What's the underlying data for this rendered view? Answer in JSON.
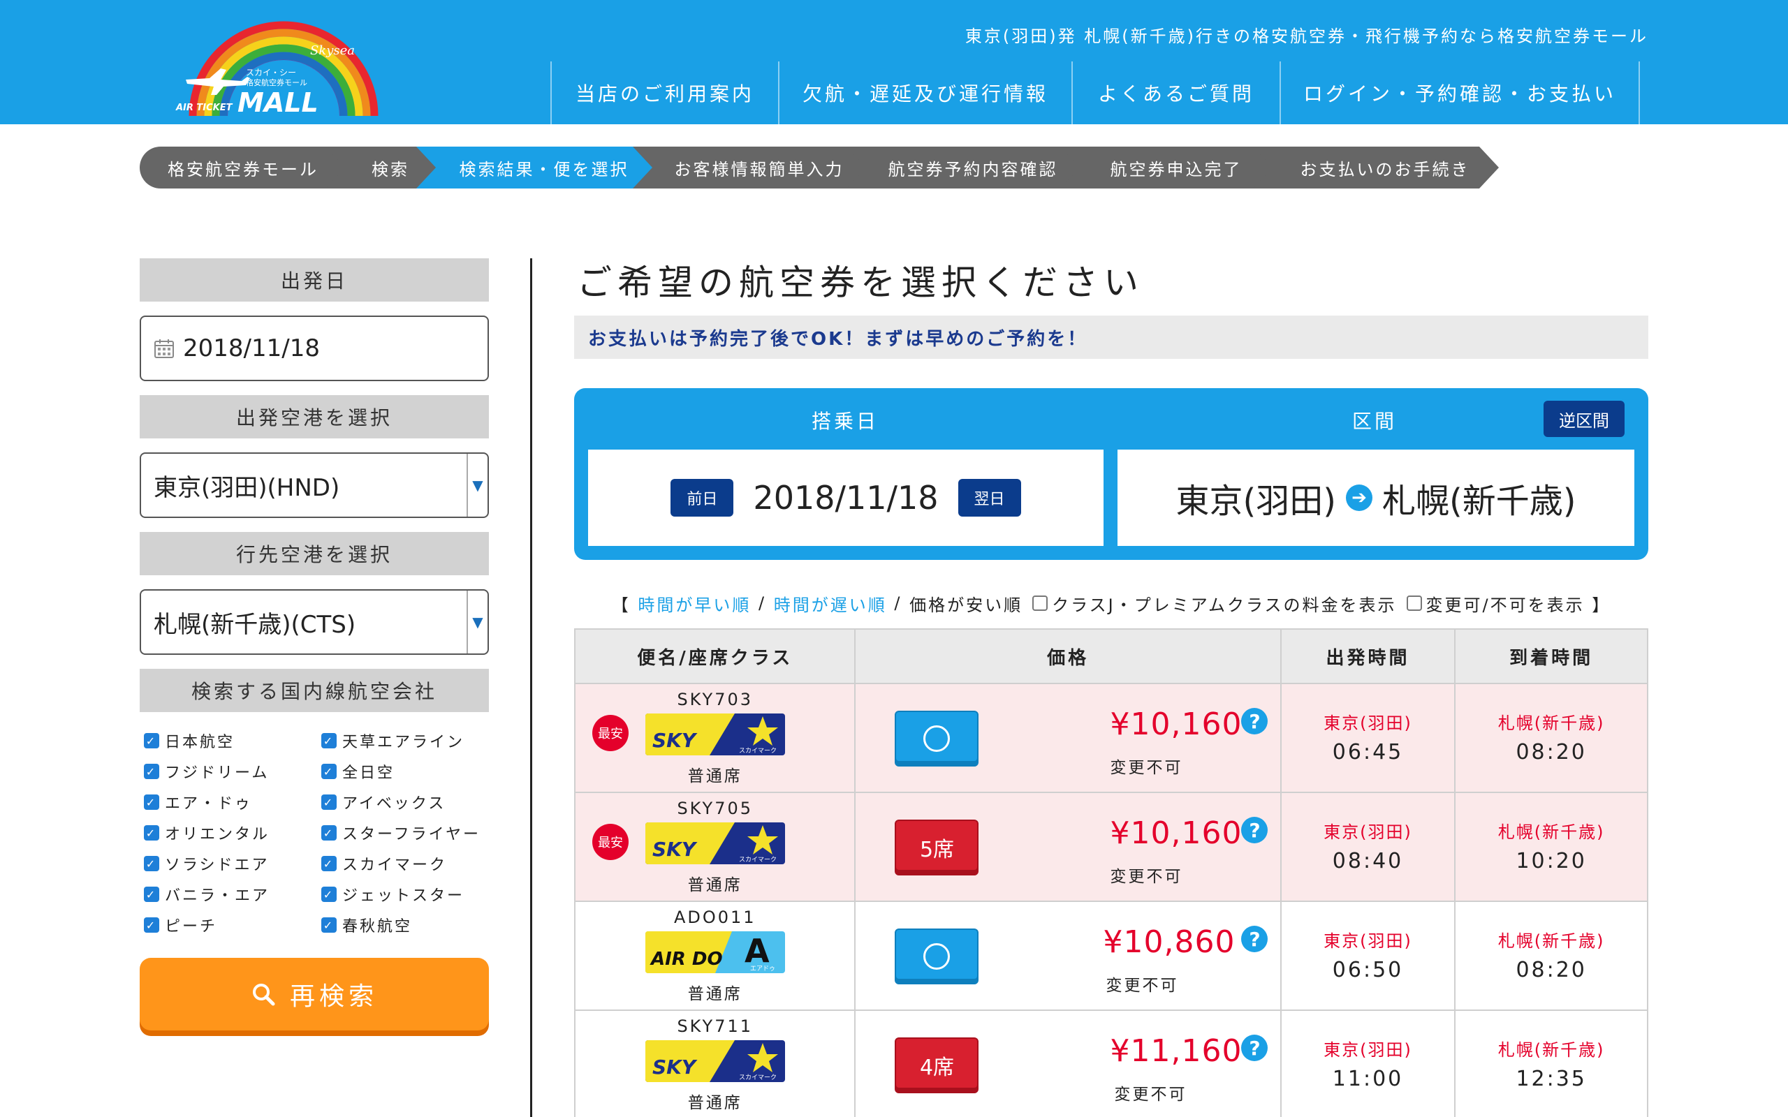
{
  "header": {
    "tagline": "東京(羽田)発 札幌(新千歳)行きの格安航空券・飛行機予約なら格安航空券モール",
    "logo": {
      "brand_small": "スカイ・シー",
      "brand_sub": "格安航空券モール",
      "script_text": "Skysea",
      "air_ticket": "AIR TICKET",
      "mall": "MALL"
    },
    "nav": [
      {
        "label": "当店のご利用案内"
      },
      {
        "label": "欠航・遅延及び運行情報"
      },
      {
        "label": "よくあるご質問"
      },
      {
        "label": "ログイン・予約確認・お支払い"
      }
    ]
  },
  "breadcrumb": [
    {
      "label": "格安航空券モール",
      "active": false
    },
    {
      "label": "検索",
      "active": false
    },
    {
      "label": "検索結果・便を選択",
      "active": true
    },
    {
      "label": "お客様情報簡単入力",
      "active": false
    },
    {
      "label": "航空券予約内容確認",
      "active": false
    },
    {
      "label": "航空券申込完了",
      "active": false
    },
    {
      "label": "お支払いのお手続き",
      "active": false
    }
  ],
  "sidebar": {
    "date_label": "出発日",
    "date_value": "2018/11/18",
    "from_label": "出発空港を選択",
    "from_value": "東京(羽田)(HND)",
    "to_label": "行先空港を選択",
    "to_value": "札幌(新千歳)(CTS)",
    "airline_label": "検索する国内線航空会社",
    "airlines": [
      "日本航空",
      "天草エアライン",
      "フジドリーム",
      "全日空",
      "エア・ドゥ",
      "アイベックス",
      "オリエンタル",
      "スターフライヤー",
      "ソラシドエア",
      "スカイマーク",
      "バニラ・エア",
      "ジェットスター",
      "ピーチ",
      "春秋航空"
    ],
    "research_label": "再検索"
  },
  "main": {
    "title": "ご希望の航空券を選択ください",
    "notice": "お支払いは予約完了後でOK！まずは早めのご予約を！",
    "search": {
      "date_header": "搭乗日",
      "route_header": "区間",
      "reverse_label": "逆区間",
      "prev_label": "前日",
      "next_label": "翌日",
      "date": "2018/11/18",
      "from": "東京(羽田)",
      "to": "札幌(新千歳)"
    },
    "sort": {
      "open": "【",
      "early": "時間が早い順",
      "sep1": "/",
      "late": "時間が遅い順",
      "sep2": "/",
      "cheap": "価格が安い順",
      "option1": "クラスJ・プレミアムクラスの料金を表示",
      "option2": "変更可/不可を表示",
      "close": "】"
    },
    "table": {
      "headers": [
        "便名/座席クラス",
        "価格",
        "出発時間",
        "到着時間"
      ],
      "rows": [
        {
          "flight": "SKY703",
          "airline": "SKY",
          "airline_kana": "スカイマーク",
          "class": "普通席",
          "cheapest": true,
          "badge": "最安",
          "seats": "",
          "price": "¥10,160",
          "change": "変更不可",
          "dep_port": "東京(羽田)",
          "dep_time": "06:45",
          "arr_port": "札幌(新千歳)",
          "arr_time": "08:20"
        },
        {
          "flight": "SKY705",
          "airline": "SKY",
          "airline_kana": "スカイマーク",
          "class": "普通席",
          "cheapest": true,
          "badge": "最安",
          "seats": "5席",
          "price": "¥10,160",
          "change": "変更不可",
          "dep_port": "東京(羽田)",
          "dep_time": "08:40",
          "arr_port": "札幌(新千歳)",
          "arr_time": "10:20"
        },
        {
          "flight": "ADO011",
          "airline": "AIR DO",
          "airline_kana": "エアドゥ",
          "class": "普通席",
          "cheapest": false,
          "badge": "",
          "seats": "",
          "price": "¥10,860",
          "change": "変更不可",
          "dep_port": "東京(羽田)",
          "dep_time": "06:50",
          "arr_port": "札幌(新千歳)",
          "arr_time": "08:20"
        },
        {
          "flight": "SKY711",
          "airline": "SKY",
          "airline_kana": "スカイマーク",
          "class": "普通席",
          "cheapest": false,
          "badge": "",
          "seats": "4席",
          "price": "¥11,160",
          "change": "変更不可",
          "dep_port": "東京(羽田)",
          "dep_time": "11:00",
          "arr_port": "札幌(新千歳)",
          "arr_time": "12:35"
        }
      ]
    }
  },
  "icons": {
    "help": "?",
    "go_arrow": "➔",
    "select_arrow": "▼",
    "check": "✓"
  },
  "colors": {
    "brand_blue": "#1aa0e6",
    "navy": "#0b3c8c",
    "price_red": "#e4002b",
    "orange": "#ff951a",
    "cheap_row": "#fbe9ea"
  }
}
